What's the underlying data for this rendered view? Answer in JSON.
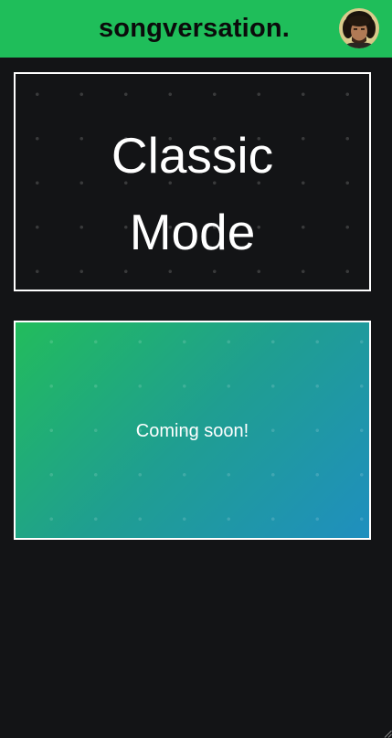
{
  "header": {
    "brand": "songversation.",
    "background_color": "#1fbe5a",
    "avatar_icon": "user-avatar-icon"
  },
  "modes": [
    {
      "label": "Classic\nMode",
      "status": ""
    },
    {
      "label": "",
      "status": "Coming soon!"
    }
  ],
  "colors": {
    "page_background": "#131416",
    "card_border": "#ffffff",
    "gradient_start": "#22bc5c",
    "gradient_end": "#1f8fbf"
  }
}
